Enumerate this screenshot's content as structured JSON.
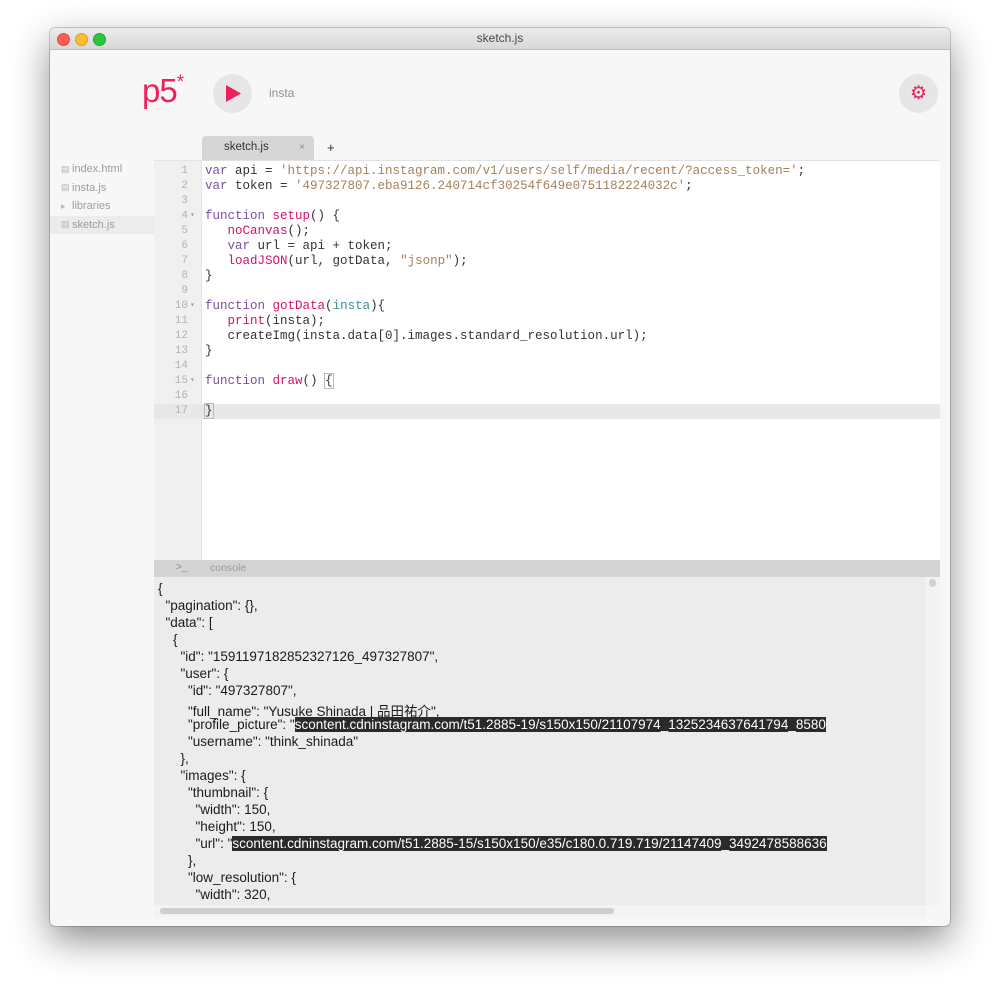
{
  "window": {
    "title": "sketch.js"
  },
  "header": {
    "logo": "p5",
    "logo_mark": "*",
    "sketch_name": "insta",
    "play_icon": "play-icon",
    "settings_icon": "gear-icon"
  },
  "tabs": [
    {
      "label": "sketch.js",
      "close": "×"
    }
  ],
  "new_tab": "+",
  "sidebar": {
    "files": [
      {
        "label": "index.html",
        "icon": "file-icon"
      },
      {
        "label": "insta.js",
        "icon": "file-icon"
      },
      {
        "label": "libraries",
        "icon": "folder-arrow-icon"
      },
      {
        "label": "sketch.js",
        "icon": "file-icon",
        "active": true
      }
    ]
  },
  "editor": {
    "lines": [
      {
        "n": "1",
        "fold": ""
      },
      {
        "n": "2",
        "fold": ""
      },
      {
        "n": "3",
        "fold": ""
      },
      {
        "n": "4",
        "fold": "▾"
      },
      {
        "n": "5",
        "fold": ""
      },
      {
        "n": "6",
        "fold": ""
      },
      {
        "n": "7",
        "fold": ""
      },
      {
        "n": "8",
        "fold": ""
      },
      {
        "n": "9",
        "fold": ""
      },
      {
        "n": "10",
        "fold": "▾"
      },
      {
        "n": "11",
        "fold": ""
      },
      {
        "n": "12",
        "fold": ""
      },
      {
        "n": "13",
        "fold": ""
      },
      {
        "n": "14",
        "fold": ""
      },
      {
        "n": "15",
        "fold": "▾"
      },
      {
        "n": "16",
        "fold": ""
      },
      {
        "n": "17",
        "fold": ""
      }
    ],
    "tokens": {
      "l1_var": "var",
      "l1_a": " api = ",
      "l1_s": "'https://api.instagram.com/v1/users/self/media/recent/?access_token='",
      "l1_e": ";",
      "l2_var": "var",
      "l2_a": " token = ",
      "l2_s": "'497327807.eba9126.240714cf30254f649e0751182224032c'",
      "l2_e": ";",
      "l4_fn": "function",
      "l4_sp": " ",
      "l4_name": "setup",
      "l4_e": "() {",
      "l5_in": "   ",
      "l5_call": "noCanvas",
      "l5_e": "();",
      "l6_in": "   ",
      "l6_var": "var",
      "l6_e": " url = api + token;",
      "l7_in": "   ",
      "l7_call": "loadJSON",
      "l7_a": "(url, gotData, ",
      "l7_s": "\"jsonp\"",
      "l7_e": ");",
      "l8": "}",
      "l10_fn": "function",
      "l10_sp": " ",
      "l10_name": "gotData",
      "l10_a": "(",
      "l10_p": "insta",
      "l10_e": "){",
      "l11_in": "   ",
      "l11_call": "print",
      "l11_e": "(insta);",
      "l12": "   createImg(insta.data[0].images.standard_resolution.url);",
      "l13": "}",
      "l15_fn": "function",
      "l15_sp": " ",
      "l15_name": "draw",
      "l15_a": "() ",
      "l15_b": "{",
      "l17": "}"
    }
  },
  "console": {
    "prompt": ">_",
    "label": "console",
    "lines": [
      "{",
      "  \"pagination\": {},",
      "  \"data\": [",
      "    {",
      "      \"id\": \"1591197182852327126_497327807\",",
      "      \"user\": {",
      "        \"id\": \"497327807\",",
      "        \"full_name\": \"Yusuke Shinada | 品田祐介\",",
      "        \"profile_picture\": \"",
      "        \"username\": \"think_shinada\"",
      "      },",
      "      \"images\": {",
      "        \"thumbnail\": {",
      "          \"width\": 150,",
      "          \"height\": 150,",
      "          \"url\": \"",
      "        },",
      "        \"low_resolution\": {",
      "          \"width\": 320,"
    ],
    "profile_picture_url": "scontent.cdninstagram.com/t51.2885-19/s150x150/21107974_1325234637641794_8580",
    "thumbnail_url": "scontent.cdninstagram.com/t51.2885-15/s150x150/e35/c180.0.719.719/21147409_3492478588636"
  }
}
